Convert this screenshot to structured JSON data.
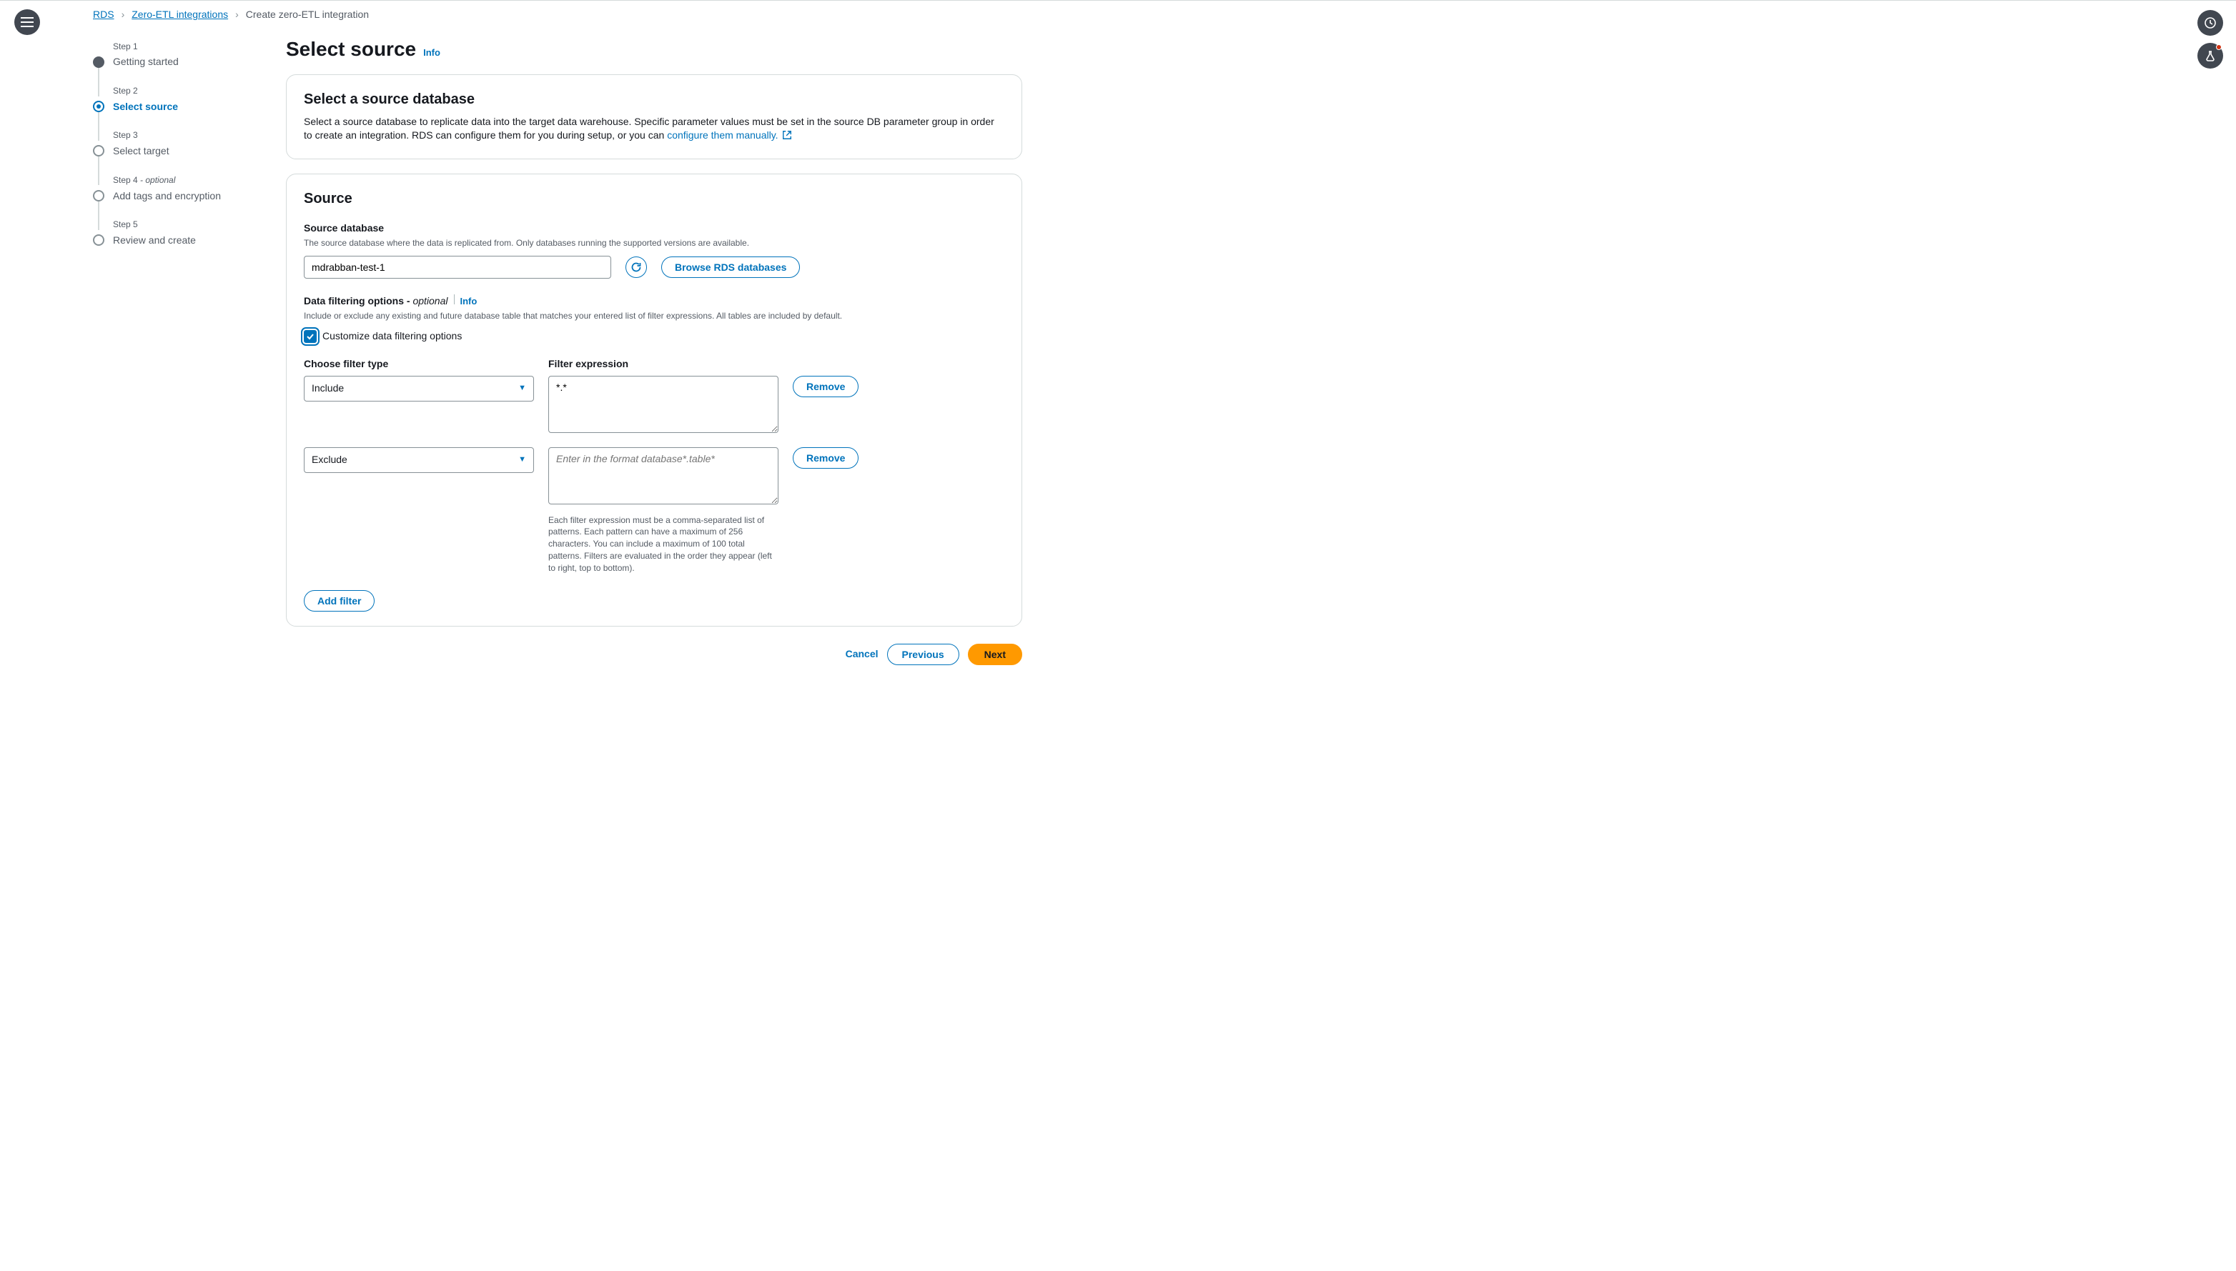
{
  "breadcrumbs": {
    "rds": "RDS",
    "zero_etl": "Zero-ETL integrations",
    "current": "Create zero-ETL integration"
  },
  "steps": [
    {
      "num": "Step 1",
      "title": "Getting started"
    },
    {
      "num": "Step 2",
      "title": "Select source"
    },
    {
      "num": "Step 3",
      "title": "Select target"
    },
    {
      "num": "Step 4 - optional",
      "title": "Add tags and encryption"
    },
    {
      "num": "Step 5",
      "title": "Review and create"
    }
  ],
  "header": {
    "title": "Select source",
    "info": "Info"
  },
  "intro_card": {
    "title": "Select a source database",
    "desc_pre": "Select a source database to replicate data into the target data warehouse. Specific parameter values must be set in the source DB parameter group in order to create an integration. RDS can configure them for you during setup, or you can ",
    "desc_link": "configure them manually."
  },
  "source_card": {
    "title": "Source",
    "db_label": "Source database",
    "db_help": "The source database where the data is replicated from. Only databases running the supported versions are available.",
    "db_value": "mdrabban-test-1",
    "browse_btn": "Browse RDS databases",
    "filter_section_label": "Data filtering options - ",
    "filter_section_optional": "optional",
    "filter_info": "Info",
    "filter_help": "Include or exclude any existing and future database table that matches your entered list of filter expressions. All tables are included by default.",
    "filter_checkbox_label": "Customize data filtering options",
    "col_type": "Choose filter type",
    "col_expr": "Filter expression",
    "rows": [
      {
        "type": "Include",
        "expr": "*.*",
        "placeholder": ""
      },
      {
        "type": "Exclude",
        "expr": "",
        "placeholder": "Enter in the format database*.table*"
      }
    ],
    "expr_help": "Each filter expression must be a comma-separated list of patterns. Each pattern can have a maximum of 256 characters. You can include a maximum of 100 total patterns. Filters are evaluated in the order they appear (left to right, top to bottom).",
    "remove": "Remove",
    "add_filter": "Add filter"
  },
  "footer": {
    "cancel": "Cancel",
    "previous": "Previous",
    "next": "Next"
  }
}
